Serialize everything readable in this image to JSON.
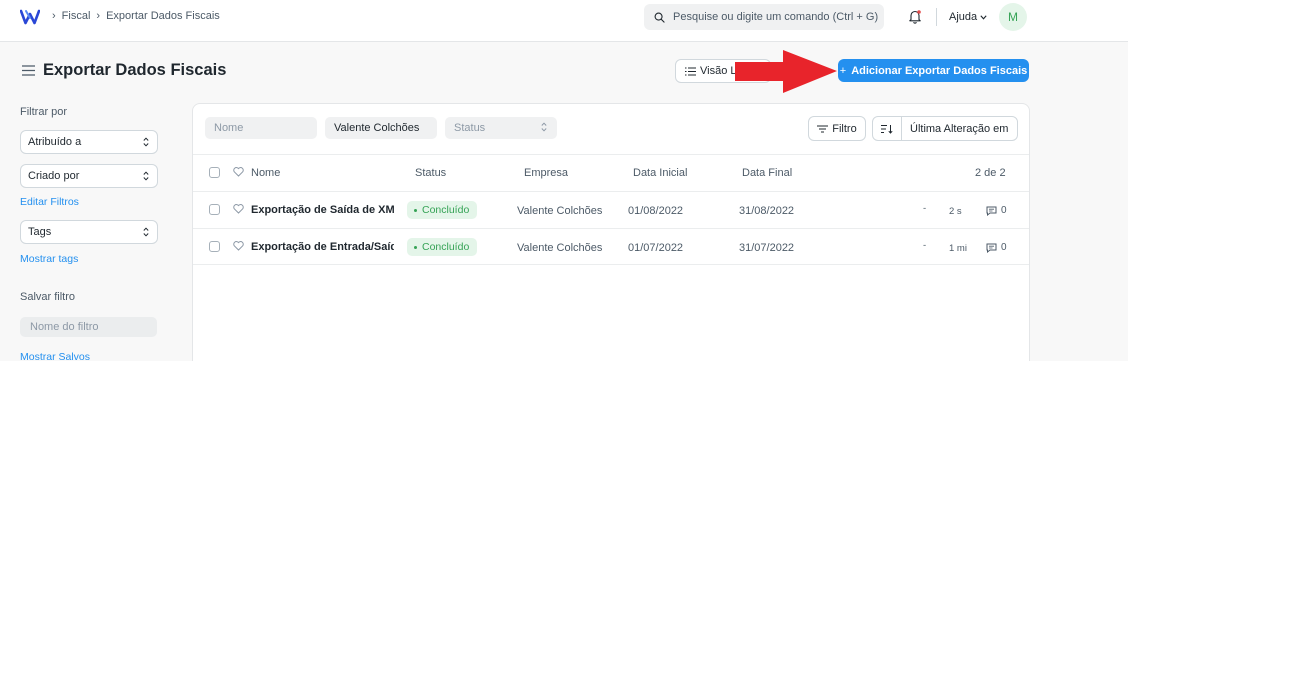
{
  "navbar": {
    "breadcrumbs": [
      "Fiscal",
      "Exportar Dados Fiscais"
    ],
    "search_placeholder": "Pesquise ou digite um comando (Ctrl + G)",
    "help_label": "Ajuda",
    "avatar_initial": "M"
  },
  "page": {
    "title": "Exportar Dados Fiscais",
    "view_button_label": "Visão L",
    "add_button_label": "Adicionar Exportar Dados Fiscais",
    "accent_color": "#2490ef",
    "arrow_color": "#e8242b"
  },
  "sidebar": {
    "filter_by_label": "Filtrar por",
    "assigned_to": "Atribuído a",
    "created_by": "Criado por",
    "edit_filters_link": "Editar Filtros",
    "tags": "Tags",
    "show_tags_link": "Mostrar tags",
    "save_filter_label": "Salvar filtro",
    "filter_name_placeholder": "Nome do filtro",
    "show_saved_link": "Mostrar Salvos"
  },
  "list": {
    "filters": {
      "name_placeholder": "Nome",
      "company_value": "Valente Colchões",
      "status_placeholder": "Status"
    },
    "filter_button_label": "Filtro",
    "sort_label": "Última Alteração em",
    "columns": {
      "name": "Nome",
      "status": "Status",
      "company": "Empresa",
      "start_date": "Data Inicial",
      "end_date": "Data Final",
      "count": "2 de 2"
    },
    "rows": [
      {
        "name": "Exportação de Saída de XML",
        "status": "Concluído",
        "company": "Valente Colchões",
        "start_date": "01/08/2022",
        "end_date": "31/08/2022",
        "dash": "-",
        "modified": "2 s",
        "comments": "0"
      },
      {
        "name": "Exportação de Entrada/Saída",
        "status": "Concluído",
        "company": "Valente Colchões",
        "start_date": "01/07/2022",
        "end_date": "31/07/2022",
        "dash": "-",
        "modified": "1 mi",
        "comments": "0"
      }
    ]
  }
}
